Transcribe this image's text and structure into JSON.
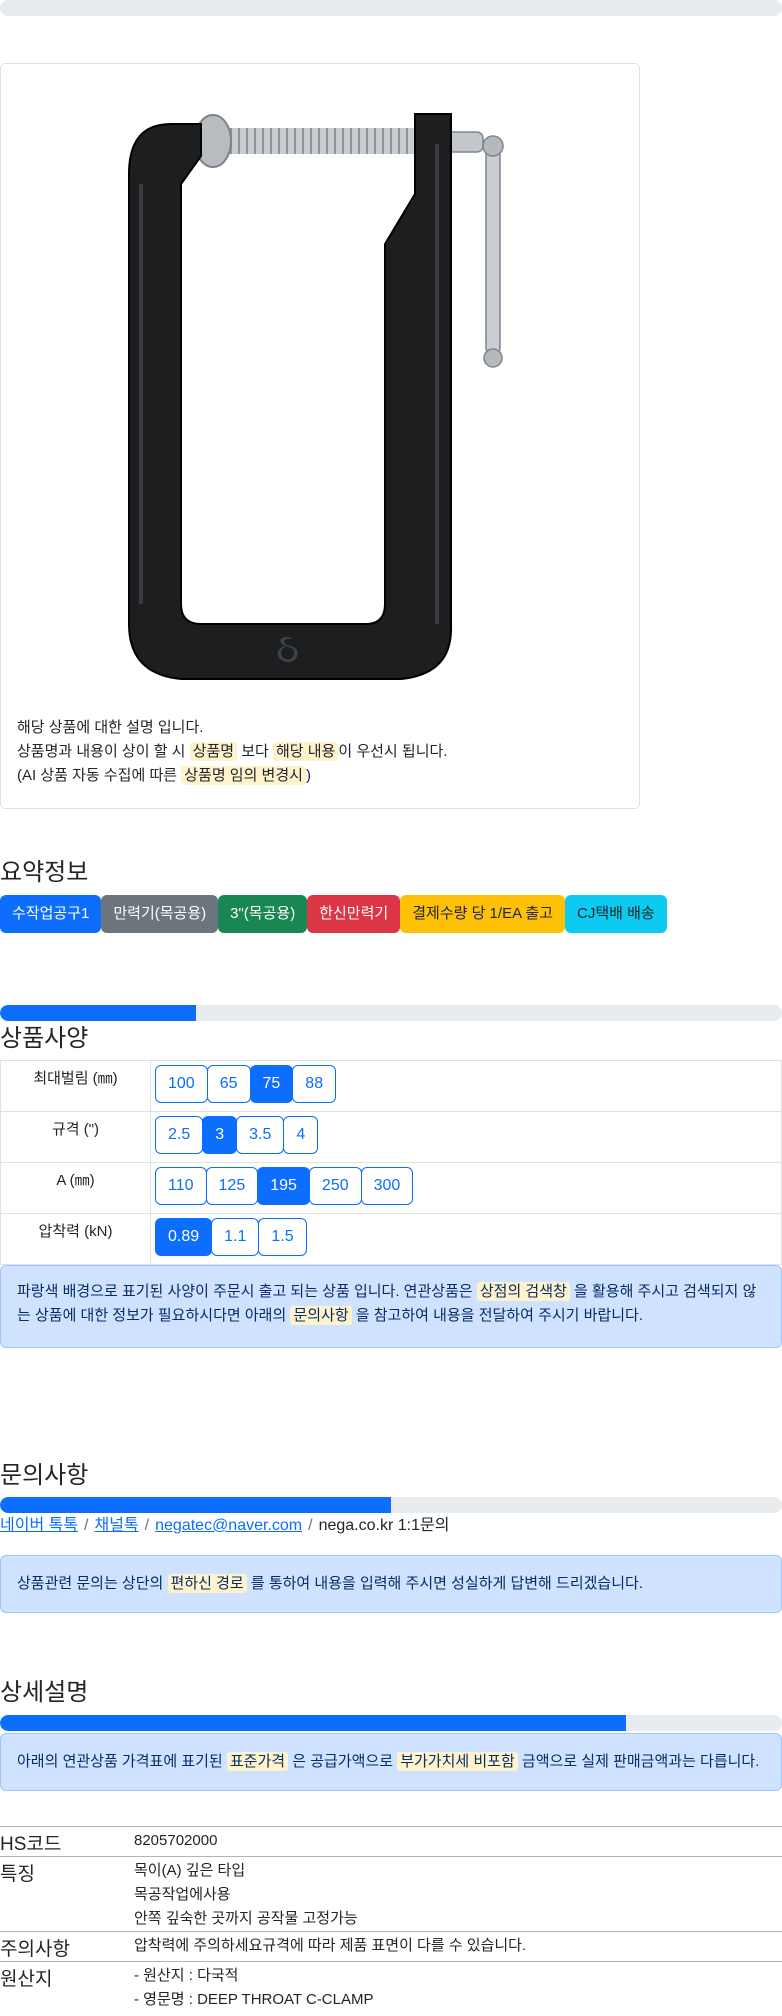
{
  "top_progress": {
    "value_percent": 0
  },
  "product_card": {
    "image_alt": "DEEP THROAT C-CLAMP",
    "desc_line1": "해당 상품에 대한 설명 입니다.",
    "desc_line2_a": "상품명과 내용이 상이 할 시 ",
    "desc_line2_b": "상품명",
    "desc_line2_c": " 보다 ",
    "desc_line2_d": "해당 내용",
    "desc_line2_e": "이 우선시 됩니다.",
    "desc_line3_a": "(AI 상품 자동 수집에 따른 ",
    "desc_line3_b": "상품명 임의 변경시",
    "desc_line3_c": ")"
  },
  "summary": {
    "title": "요약정보",
    "badges": [
      {
        "label": "수작업공구1",
        "color": "#0d6efd"
      },
      {
        "label": "만력기(목공용)",
        "color": "#6c757d"
      },
      {
        "label": "3\"(목공용)",
        "color": "#198754"
      },
      {
        "label": "한신만력기",
        "color": "#dc3545"
      },
      {
        "label": "결제수량 당 1/EA 출고",
        "color": "#ffc107"
      },
      {
        "label": "CJ택배 배송",
        "color": "#0dcaf0"
      }
    ]
  },
  "specs": {
    "progress_percent": 25,
    "title": "상품사양",
    "rows": [
      {
        "label": "최대벌림 (㎜)",
        "options": [
          "100",
          "65",
          "75",
          "88"
        ],
        "selected": "75"
      },
      {
        "label": "규격 (\")",
        "options": [
          "2.5",
          "3",
          "3.5",
          "4"
        ],
        "selected": "3"
      },
      {
        "label": "A (㎜)",
        "options": [
          "110",
          "125",
          "195",
          "250",
          "300"
        ],
        "selected": "195"
      },
      {
        "label": "압착력 (kN)",
        "options": [
          "0.89",
          "1.1",
          "1.5"
        ],
        "selected": "0.89"
      }
    ],
    "notice_a": "파랑색 배경으로 표기된 사양이 주문시 출고 되는 상품 입니다. 연관상품은 ",
    "notice_b": "상점의 검색창",
    "notice_c": " 을 활용해 주시고 검색되지 않는 상품에 대한 정보가 필요하시다면 아래의 ",
    "notice_d": "문의사항",
    "notice_e": " 을 참고하여 내용을 전달하여 주시기 바랍니다."
  },
  "inquiry": {
    "title": "문의사항",
    "progress_percent": 50,
    "link1": "네이버 톡톡",
    "link2": "채널톡",
    "link3": "negatec@naver.com",
    "sep": "/",
    "plain": "nega.co.kr 1:1문의",
    "notice_a": "상품관련 문의는 상단의 ",
    "notice_b": "편하신 경로",
    "notice_c": " 를 통하여 내용을 입력해 주시면 성실하게 답변해 드리겠습니다."
  },
  "detail": {
    "title": "상세설명",
    "progress_percent": 80,
    "notice_a": "아래의 연관상품 가격표에 표기된 ",
    "notice_b": "표준가격",
    "notice_c": " 은 공급가액으로 ",
    "notice_d": "부가가치세 비포함",
    "notice_e": " 금액으로 실제 판매금액과는 다릅니다.",
    "rows": [
      {
        "key": "HS코드",
        "lines": [
          "8205702000"
        ]
      },
      {
        "key": "특징",
        "lines": [
          "목이(A) 깊은 타입",
          "목공작업에사용",
          "안쪽 깊숙한 곳까지 공작물 고정가능"
        ]
      },
      {
        "key": "주의사항",
        "lines": [
          "압착력에 주의하세요규격에 따라 제품 표면이 다를 수 있습니다."
        ]
      },
      {
        "key": "원산지",
        "lines": [
          "- 원산지 : 다국적",
          "- 영문명 : DEEP THROAT C-CLAMP"
        ]
      }
    ]
  }
}
